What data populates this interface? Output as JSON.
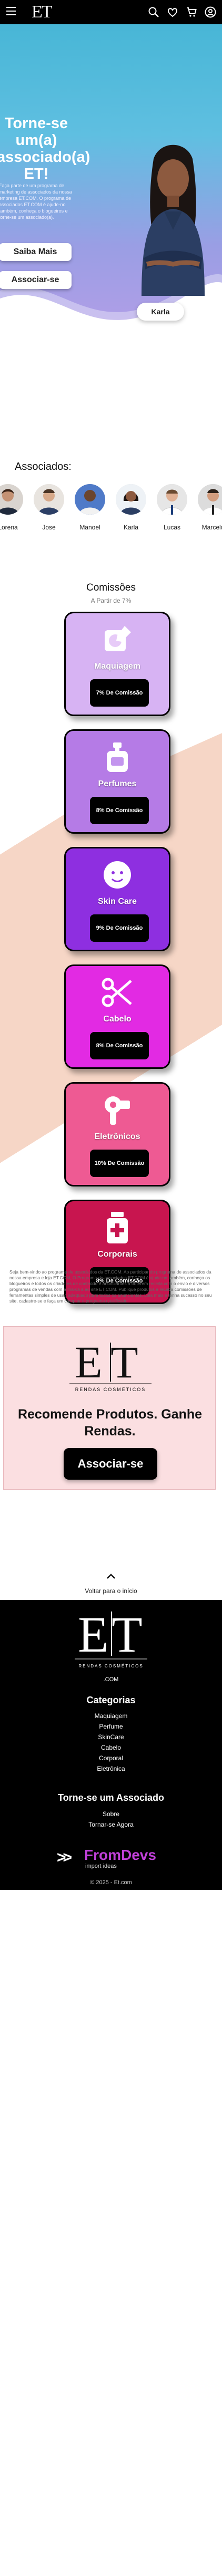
{
  "header": {
    "logo_text": "ET",
    "icons": [
      "menu-icon",
      "search-icon",
      "heart-icon",
      "cart-icon",
      "user-icon"
    ]
  },
  "hero": {
    "title": "Torne-se um(a) associado(a) ET!",
    "lead": "Faça parte de um programa de marketing de associados da nossa empresa ET.COM. O programa de associados ET.COM é ajude-no também, conheça o blogueiros e torne-se um associado(a).",
    "btn_more": "Saiba Mais",
    "btn_join": "Associar-se",
    "featured_name": "Karla"
  },
  "associates": {
    "title": "Associados:",
    "people": [
      "Lorena",
      "Jose",
      "Manoel",
      "Karla",
      "Lucas",
      "Marcelo"
    ]
  },
  "commissions": {
    "title": "Comissões",
    "subtitle": "A Partir de 7%",
    "cards": [
      {
        "name": "Maquiagem",
        "badge": "7% De Comissão",
        "color": "#d7b3f3",
        "icon": "makeup-icon"
      },
      {
        "name": "Perfumes",
        "badge": "8% De Comissão",
        "color": "#b57be6",
        "icon": "perfume-icon"
      },
      {
        "name": "Skin Care",
        "badge": "9% De Comissão",
        "color": "#8e2fe0",
        "icon": "skin-care-icon"
      },
      {
        "name": "Cabelo",
        "badge": "8% De Comissão",
        "color": "#e22ae3",
        "icon": "scissors-icon"
      },
      {
        "name": "Eletrônicos",
        "badge": "10% De Comissão",
        "color": "#ee5a93",
        "icon": "hair-dryer-icon"
      },
      {
        "name": "Corporais",
        "badge": "8% De Comissão",
        "color": "#c8154f",
        "icon": "body-care-icon"
      }
    ]
  },
  "disclaimer": "Seja bem-vindo ao programa de associados da ET.COM. Ao participar do programa de associados da nossa empresa e loja ET.COM, O Programa de associados ET.COM é ajude-no também, conheça os blogueiros e todos os criadores de conteúdo e anunciantes a obterem receita com o envio e diversos programas de vendas com a marca a ao site ET.COM. Publique produtos e receba comissões de ferramentas simples de usar, adequado para todos os anunciantes. Leia mais e tenha sucesso no seu site, cadastre-se e faça um comprar o programa qualificado.",
  "recommend": {
    "logo_text": "ET",
    "logo_subtitle": "RENDAS COSMÉTICOS",
    "title": "Recomende Produtos. Ganhe Rendas.",
    "button": "Associar-se"
  },
  "footer": {
    "back_to_top": "Voltar para o início",
    "logo_text": "ET",
    "logo_subtitle": "RENDAS COSMÉTICOS",
    "domain": ".COM",
    "categories_title": "Categorias",
    "categories": [
      "Maquiagem",
      "Perfume",
      "SkinCare",
      "Cabelo",
      "Corporal",
      "Eletrônica"
    ],
    "associate_title": "Torne-se um Associado",
    "associate_links": [
      "Sobre",
      "Tornar-se Agora"
    ],
    "dev_brand": "FromDevs",
    "dev_sub": "import ideas",
    "copyright": "© 2025 - Et.com"
  }
}
